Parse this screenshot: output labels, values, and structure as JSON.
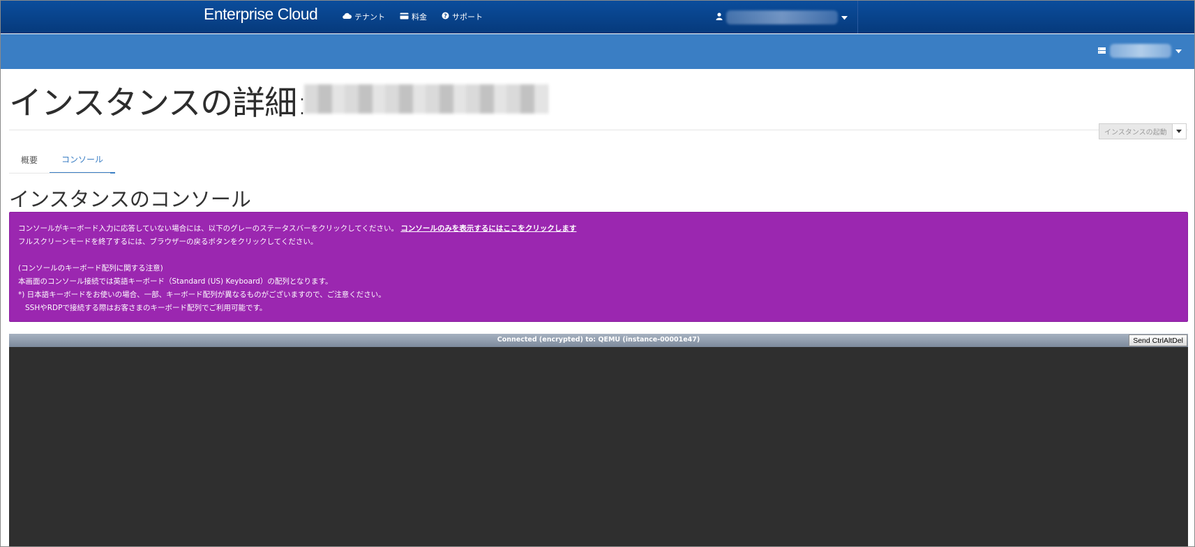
{
  "header": {
    "brand": "Enterprise Cloud",
    "nav": [
      {
        "label": "テナント",
        "icon": "cloud-icon"
      },
      {
        "label": "料金",
        "icon": "credit-card-icon"
      },
      {
        "label": "サポート",
        "icon": "question-circle-icon"
      }
    ],
    "user_icon": "user-icon"
  },
  "subheader": {
    "project_icon": "server-icon"
  },
  "page": {
    "title": "インスタンスの詳細:",
    "launch_button": "インスタンスの起動"
  },
  "tabs": [
    {
      "label": "概要",
      "active": false
    },
    {
      "label": "コンソール",
      "active": true
    }
  ],
  "section_title": "インスタンスのコンソール",
  "alert": {
    "line1": "コンソールがキーボード入力に応答していない場合には、以下のグレーのステータスバーをクリックしてください。",
    "link": "コンソールのみを表示するにはここをクリックします",
    "line2": "フルスクリーンモードを終了するには、ブラウザーの戻るボタンをクリックしてください。",
    "line3": "(コンソールのキーボード配列に関する注意)",
    "line4": "本画面のコンソール接続では英語キーボード（Standard (US) Keyboard）の配列となります。",
    "line5": "*) 日本語キーボードをお使いの場合、一部、キーボード配列が異なるものがございますので、ご注意ください。",
    "line6": "SSHやRDPで接続する際はお客さまのキーボード配列でご利用可能です。",
    "background_color": "#9b27b0"
  },
  "console": {
    "status": "Connected (encrypted) to: QEMU (instance-00001e47)",
    "ctrl_alt_del": "Send CtrlAltDel"
  }
}
